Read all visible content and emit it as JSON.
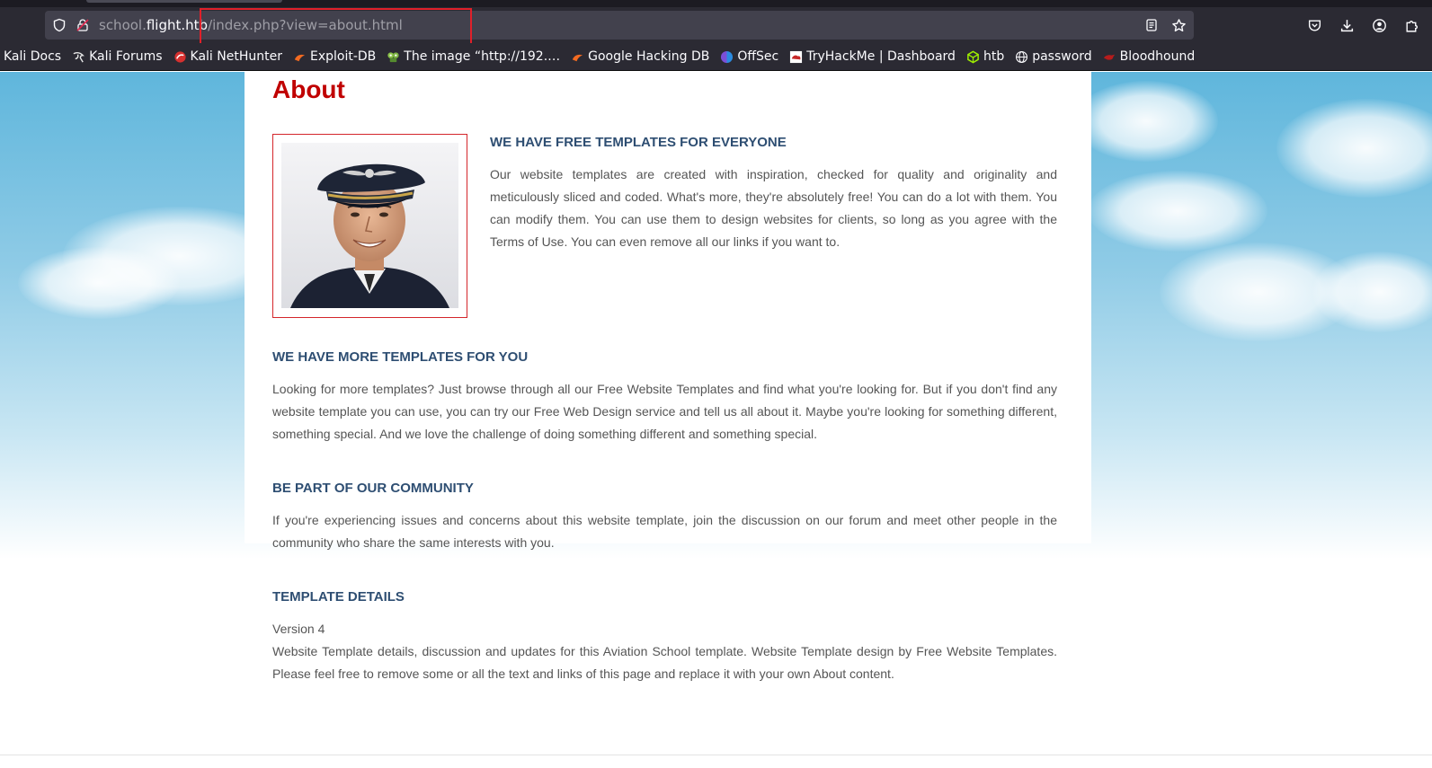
{
  "browser": {
    "url": {
      "subdomain": "school.",
      "host": "flight.htb",
      "path": "/index.php?view=about.html"
    },
    "bookmarks": [
      {
        "label": "Kali Docs",
        "icon": "kali-icon"
      },
      {
        "label": "Kali Forums",
        "icon": "kali-dragon-icon"
      },
      {
        "label": "Kali NetHunter",
        "icon": "nethunter-icon"
      },
      {
        "label": "Exploit-DB",
        "icon": "exploit-db-icon"
      },
      {
        "label": "The image “http://192.…",
        "icon": "image-icon"
      },
      {
        "label": "Google Hacking DB",
        "icon": "exploit-db-icon"
      },
      {
        "label": "OffSec",
        "icon": "offsec-icon"
      },
      {
        "label": "TryHackMe | Dashboard",
        "icon": "tryhackme-icon"
      },
      {
        "label": "htb",
        "icon": "htb-cube-icon"
      },
      {
        "label": "password",
        "icon": "globe-icon"
      },
      {
        "label": "Bloodhound",
        "icon": "bloodhound-icon"
      }
    ]
  },
  "page": {
    "title": "About",
    "sections": [
      {
        "heading": "WE HAVE FREE TEMPLATES FOR EVERYONE",
        "body": "Our website templates are created with inspiration, checked for quality and originality and meticulously sliced and coded. What's more, they're absolutely free! You can do a lot with them. You can modify them. You can use them to design websites for clients, so long as you agree with the Terms of Use. You can even remove all our links if you want to."
      },
      {
        "heading": "WE HAVE MORE TEMPLATES FOR YOU",
        "body": "Looking for more templates? Just browse through all our Free Website Templates and find what you're looking for. But if you don't find any website template you can use, you can try our Free Web Design service and tell us all about it. Maybe you're looking for something different, something special. And we love the challenge of doing something different and something special."
      },
      {
        "heading": "BE PART OF OUR COMMUNITY",
        "body": "If you're experiencing issues and concerns about this website template, join the discussion on our forum and meet other people in the community who share the same interests with you."
      },
      {
        "heading": "TEMPLATE DETAILS",
        "version": "Version 4",
        "body": "Website Template details, discussion and updates for this Aviation School template. Website Template design by Free Website Templates. Please feel free to remove some or all the text and links of this page and replace it with your own About content."
      }
    ]
  },
  "colors": {
    "title_red": "#c00000",
    "heading_blue": "#2e4e72",
    "highlight_red": "#e0202a",
    "chrome_bg": "#2b2a33"
  }
}
